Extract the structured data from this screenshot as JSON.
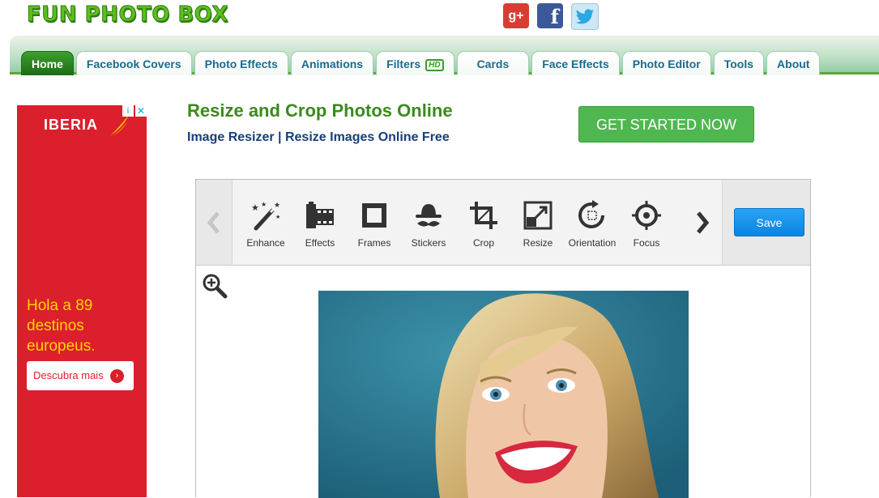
{
  "logo": "FUN PHOTO BOX",
  "social": {
    "gplus": "g+",
    "facebook": "f"
  },
  "nav": [
    {
      "label": "Home",
      "active": true
    },
    {
      "label": "Facebook Covers"
    },
    {
      "label": "Photo Effects"
    },
    {
      "label": "Animations"
    },
    {
      "label": "Filters",
      "badge": "HD"
    },
    {
      "label": "Cards"
    },
    {
      "label": "Face Effects"
    },
    {
      "label": "Photo Editor"
    },
    {
      "label": "Tools"
    },
    {
      "label": "About"
    }
  ],
  "ad": {
    "brand": "IBERIA",
    "info": "i",
    "close": "✕",
    "line1": "Hola a 89",
    "line2": "destinos",
    "line3": "europeus.",
    "button": "Descubra mais",
    "button_arrow": "›"
  },
  "page": {
    "title": "Resize and Crop Photos Online",
    "subtitle": "Image Resizer | Resize Images Online Free",
    "cta": "GET STARTED NOW"
  },
  "editor": {
    "tools": [
      {
        "label": "Enhance",
        "icon": "magic-wand-icon"
      },
      {
        "label": "Effects",
        "icon": "film-icon"
      },
      {
        "label": "Frames",
        "icon": "frame-icon"
      },
      {
        "label": "Stickers",
        "icon": "hat-mustache-icon"
      },
      {
        "label": "Crop",
        "icon": "crop-icon"
      },
      {
        "label": "Resize",
        "icon": "resize-icon"
      },
      {
        "label": "Orientation",
        "icon": "rotate-icon"
      },
      {
        "label": "Focus",
        "icon": "target-icon"
      }
    ],
    "save": "Save"
  },
  "colors": {
    "brand_green": "#3b8a1d",
    "cta_green": "#4fb74f",
    "save_blue": "#0a84df",
    "ad_red": "#dc1f2c"
  }
}
